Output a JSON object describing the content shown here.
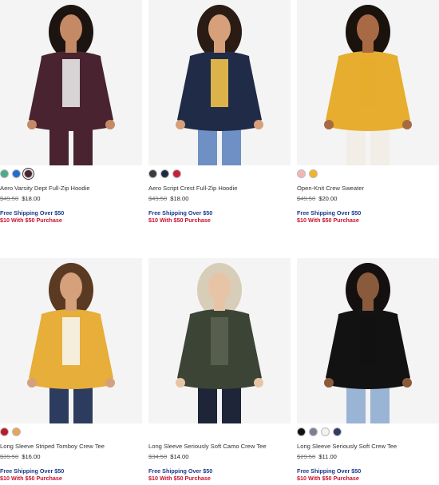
{
  "products": [
    {
      "title": "Aero Varsity Dept Full-Zip Hoodie",
      "was": "$49.50",
      "now": "$18.00",
      "promo_shipping": "Free Shipping Over $50",
      "promo_discount": "$10 With $50 Purchase",
      "swatches": [
        "#4daa8a",
        "#1f6fd1",
        "#4a2330"
      ],
      "photo": {
        "bg": "#f4f4f4",
        "garment": "#4a2330",
        "accent": "#e8e8e8",
        "pants": "#4a2330",
        "skin": "#c48a66",
        "hair": "#1c1410"
      }
    },
    {
      "title": "Aero Script Crest Full-Zip Hoodie",
      "was": "$49.50",
      "now": "$18.00",
      "promo_shipping": "Free Shipping Over $50",
      "promo_discount": "$10 With $50 Purchase",
      "swatches": [
        "#3a3a40",
        "#1e2a44",
        "#c81e3a"
      ],
      "photo": {
        "bg": "#f4f4f4",
        "garment": "#1f2b47",
        "accent": "#f0c24a",
        "pants": "#6f90c4",
        "skin": "#d6a07a",
        "hair": "#2a1c14"
      }
    },
    {
      "title": "Open-Knit Crew Sweater",
      "was": "$49.50",
      "now": "$20.00",
      "promo_shipping": "Free Shipping Over $50",
      "promo_discount": "$10 With $50 Purchase",
      "swatches": [
        "#f3b6b6",
        "#f0b429"
      ],
      "photo": {
        "bg": "#f4f4f4",
        "garment": "#e6ad2e",
        "accent": "#e6ad2e",
        "pants": "#f2ede6",
        "skin": "#a86a44",
        "hair": "#1a120c"
      }
    },
    {
      "title": "Long Sleeve Striped Tomboy Crew Tee",
      "was": "$39.50",
      "now": "$16.00",
      "promo_shipping": "Free Shipping Over $50",
      "promo_discount": "$10 With $50 Purchase",
      "swatches": [
        "#b81c2c",
        "#e9a45b"
      ],
      "photo": {
        "bg": "#f4f4f4",
        "garment": "#e7ae3a",
        "accent": "#f7f5f0",
        "pants": "#2c3c5e",
        "skin": "#d5a07c",
        "hair": "#5a3a22"
      }
    },
    {
      "title": "Long Sleeve Seriously Soft Camo Crew Tee",
      "was": "$34.50",
      "now": "$14.00",
      "promo_shipping": "Free Shipping Over $50",
      "promo_discount": "$10 With $50 Purchase",
      "swatches": [],
      "photo": {
        "bg": "#f4f4f4",
        "garment": "#3c4436",
        "accent": "#5a6250",
        "pants": "#1e2538",
        "skin": "#e8c4a6",
        "hair": "#d8cdb8"
      }
    },
    {
      "title": "Long Sleeve Seriously Soft Crew Tee",
      "was": "$29.50",
      "now": "$11.00",
      "promo_shipping": "Free Shipping Over $50",
      "promo_discount": "$10 With $50 Purchase",
      "swatches": [
        "#111111",
        "#7a8090",
        "#f2f2f2",
        "#2f3b66"
      ],
      "photo": {
        "bg": "#f4f4f4",
        "garment": "#121212",
        "accent": "#121212",
        "pants": "#9ab4d6",
        "skin": "#8a5a3c",
        "hair": "#141010"
      }
    }
  ]
}
